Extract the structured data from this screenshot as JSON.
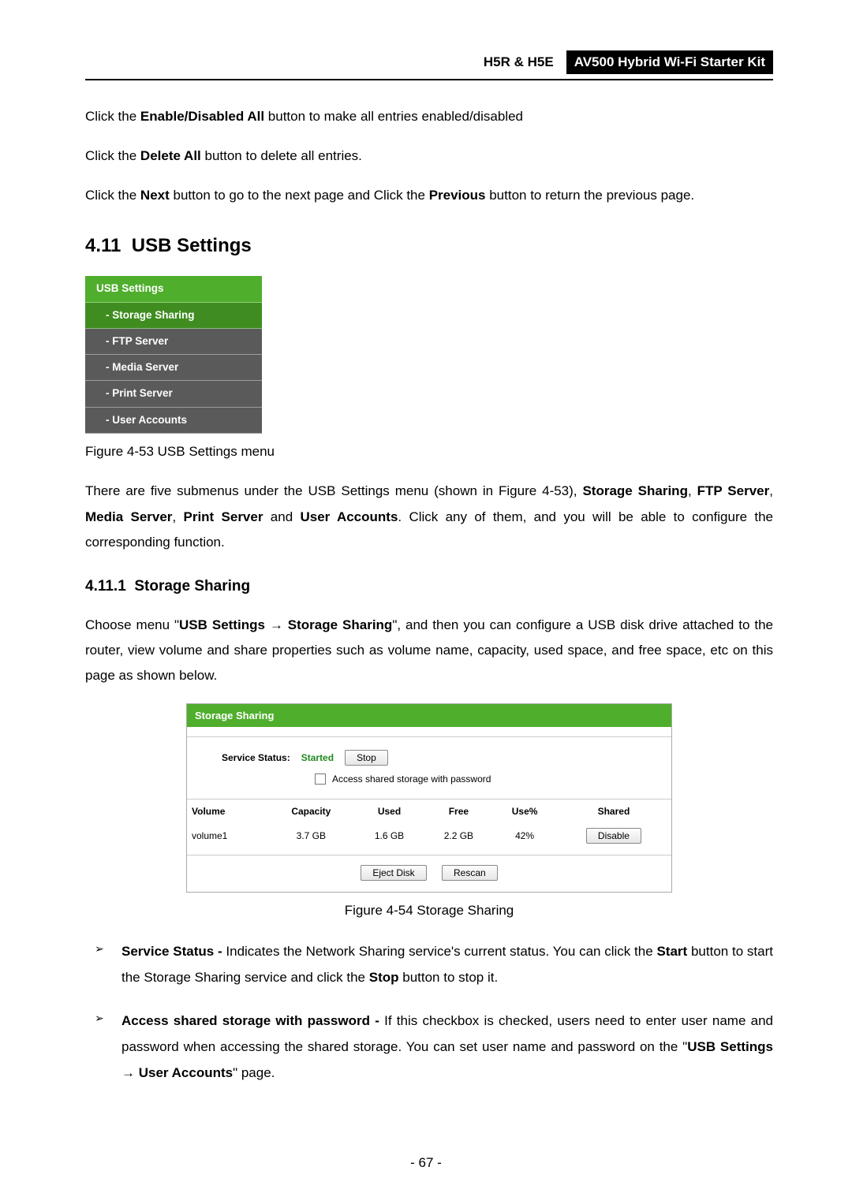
{
  "header": {
    "left": "H5R & H5E",
    "right": "AV500 Hybrid Wi-Fi Starter Kit"
  },
  "intro": {
    "p1_a": "Click the ",
    "p1_b": "Enable/Disabled All",
    "p1_c": " button to make all entries enabled/disabled",
    "p2_a": "Click the ",
    "p2_b": "Delete All",
    "p2_c": " button to delete all entries.",
    "p3_a": "Click the ",
    "p3_b": "Next",
    "p3_c": " button to go to the next page and Click the ",
    "p3_d": "Previous",
    "p3_e": " button to return the previous page."
  },
  "section": {
    "num": "4.11",
    "title": "USB Settings"
  },
  "usb_menu": {
    "header": "USB Settings",
    "items": [
      {
        "label": "- Storage Sharing",
        "selected": true
      },
      {
        "label": "- FTP Server",
        "selected": false
      },
      {
        "label": "- Media Server",
        "selected": false
      },
      {
        "label": "- Print Server",
        "selected": false
      },
      {
        "label": "- User Accounts",
        "selected": false
      }
    ]
  },
  "fig453_caption": "Figure 4-53 USB Settings menu",
  "para_after_menu": {
    "a": "There are five submenus under the USB Settings menu (shown in Figure 4-53), ",
    "b": "Storage Sharing",
    "c": ", ",
    "d": "FTP Server",
    "e": ", ",
    "f": "Media Server",
    "g": ", ",
    "h": "Print Server",
    "i": " and ",
    "j": "User Accounts",
    "k": ". Click any of them, and you will be able to configure the corresponding function."
  },
  "subsection": {
    "num": "4.11.1",
    "title": "Storage Sharing"
  },
  "para_ss": {
    "a": "Choose menu \"",
    "b": "USB Settings",
    "arrow": " → ",
    "c": "Storage Sharing",
    "d": "\", and then you can configure a USB disk drive attached to the router, view volume and share properties such as volume name, capacity, used space, and free space, etc on this page as shown below."
  },
  "ss_panel": {
    "title": "Storage Sharing",
    "status_label": "Service Status:",
    "status_value": "Started",
    "stop_btn": "Stop",
    "checkbox_label": "Access shared storage with password",
    "cols": {
      "volume": "Volume",
      "capacity": "Capacity",
      "used": "Used",
      "free": "Free",
      "usepct": "Use%",
      "shared": "Shared"
    },
    "row": {
      "volume": "volume1",
      "capacity": "3.7 GB",
      "used": "1.6 GB",
      "free": "2.2 GB",
      "usepct": "42%",
      "shared_btn": "Disable"
    },
    "eject_btn": "Eject Disk",
    "rescan_btn": "Rescan"
  },
  "fig454_caption": "Figure 4-54 Storage Sharing",
  "explain_list": {
    "i1": {
      "b1": "Service Status -",
      "t1": " Indicates the Network Sharing service's current status. You can click the ",
      "b2": "Start",
      "t2": " button to start the Storage Sharing service and click the ",
      "b3": "Stop",
      "t3": " button to stop it."
    },
    "i2": {
      "b1": "Access shared storage with password -",
      "t1": " If this checkbox is checked, users need to enter user name and password when accessing the shared storage. You can set user name and password on the \"",
      "b2": "USB Settings",
      "arrow": " → ",
      "b3": "User Accounts",
      "t2": "\" page."
    }
  },
  "page_number": "- 67 -"
}
